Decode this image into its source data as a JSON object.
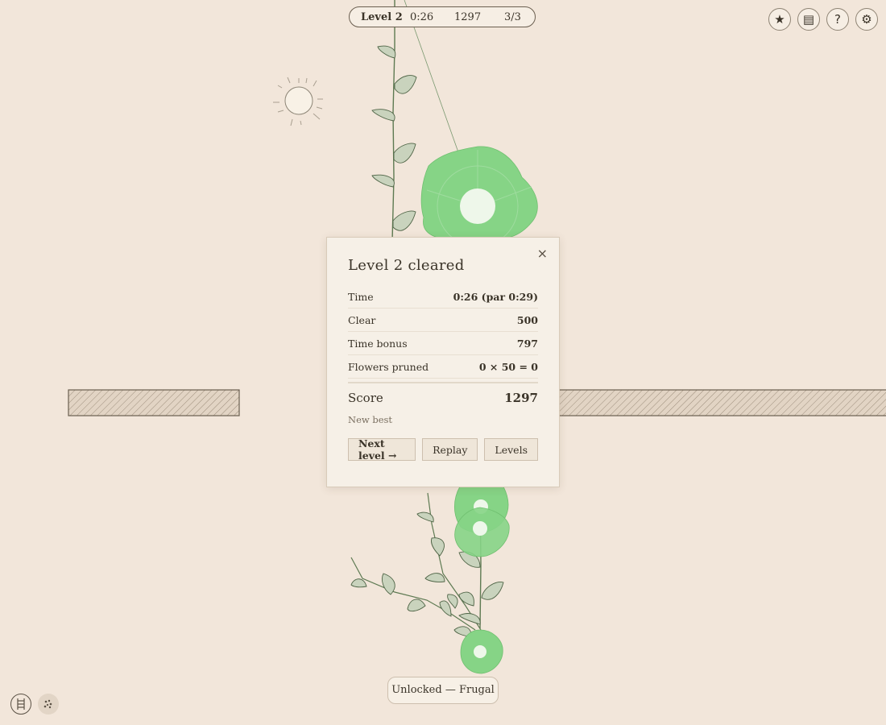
{
  "hud": {
    "level": "Level 2",
    "time": "0:26",
    "score": "1297",
    "progress": "3/3"
  },
  "top_icons": [
    "star-icon",
    "journal-icon",
    "help-icon",
    "settings-icon"
  ],
  "top_icon_glyphs": {
    "star": "★",
    "journal": "▤",
    "help": "?",
    "settings": "⚙"
  },
  "bottom_icons": [
    "ladder-icon",
    "seeds-icon"
  ],
  "modal": {
    "title": "Level 2 cleared",
    "close": "×",
    "rows": [
      {
        "label": "Time",
        "value": "0:26 (par 0:29)"
      },
      {
        "label": "Clear",
        "value": "500"
      },
      {
        "label": "Time bonus",
        "value": "797"
      },
      {
        "label": "Flowers pruned",
        "value": "0 × 50 = 0"
      }
    ],
    "score_label": "Score",
    "score_value": "1297",
    "note": "New best",
    "buttons": {
      "next": "Next level →",
      "replay": "Replay",
      "levels": "Levels"
    }
  },
  "toast": "Unlocked — Frugal",
  "colors": {
    "background": "#f2e6da",
    "flower": "#86d486",
    "leaf": "#c9d3bd",
    "stem": "#5e7a52"
  }
}
